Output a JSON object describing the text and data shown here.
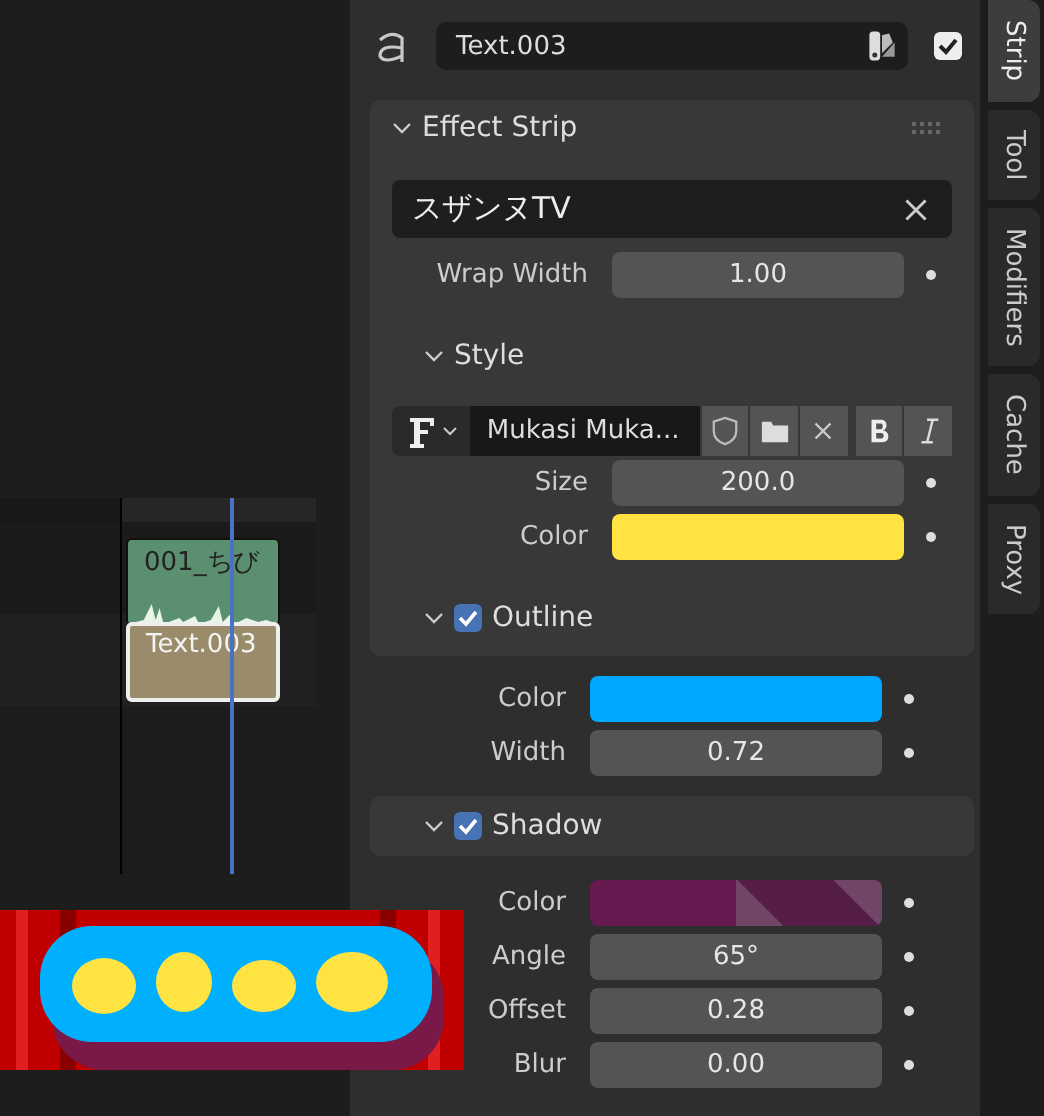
{
  "sequencer": {
    "strips": [
      {
        "kind": "sound",
        "label": "001_ちび",
        "selected": false
      },
      {
        "kind": "text",
        "label": "Text.003",
        "selected": true
      }
    ]
  },
  "header": {
    "name": "Text.003",
    "enabled": true
  },
  "panel": {
    "title": "Effect Strip",
    "expanded": true,
    "text": "スザンヌTV",
    "wrap": {
      "label": "Wrap Width",
      "value": "1.00"
    },
    "style": {
      "title": "Style",
      "expanded": true,
      "font": "Mukasi Muka...",
      "rows": [
        {
          "kind": "number",
          "label": "Size",
          "value": "200.0"
        },
        {
          "kind": "color",
          "label": "Color",
          "color": "#ffe342"
        }
      ]
    },
    "outline": {
      "title": "Outline",
      "checked": true,
      "expanded": true,
      "rows": [
        {
          "kind": "color",
          "label": "Color",
          "color": "#00a8ff"
        },
        {
          "kind": "number",
          "label": "Width",
          "value": "0.72"
        }
      ]
    },
    "shadow": {
      "title": "Shadow",
      "checked": true,
      "expanded": true,
      "rows": [
        {
          "kind": "color",
          "label": "Color",
          "color": "#651a50"
        },
        {
          "kind": "number",
          "label": "Angle",
          "value": "65°"
        },
        {
          "kind": "number",
          "label": "Offset",
          "value": "0.28"
        },
        {
          "kind": "number",
          "label": "Blur",
          "value": "0.00"
        }
      ]
    }
  },
  "tabs": [
    {
      "label": "Strip",
      "selected": true
    },
    {
      "label": "Tool",
      "selected": false
    },
    {
      "label": "Modifiers",
      "selected": false
    },
    {
      "label": "Cache",
      "selected": false
    },
    {
      "label": "Proxy",
      "selected": false
    }
  ]
}
